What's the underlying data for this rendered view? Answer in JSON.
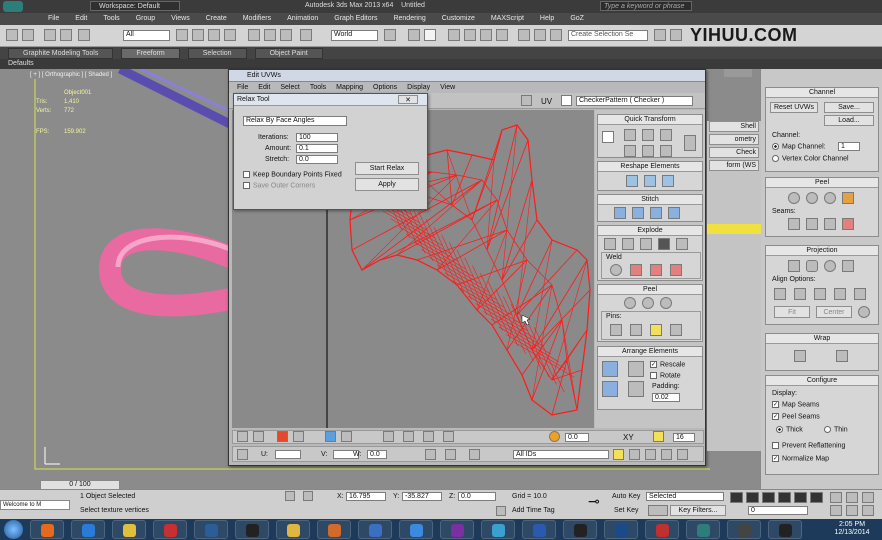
{
  "app": {
    "title": "Autodesk 3ds Max 2013 x64",
    "doc": "Untitled",
    "workspace": "Workspace: Default",
    "search_placeholder": "Type a keyword or phrase"
  },
  "menu": [
    "File",
    "Edit",
    "Tools",
    "Group",
    "Views",
    "Create",
    "Modifiers",
    "Animation",
    "Graph Editors",
    "Rendering",
    "Customize",
    "MAXScript",
    "Help",
    "GoZ"
  ],
  "toolbar": {
    "filter": "All",
    "coord": "World",
    "sel_set": "Create Selection Se"
  },
  "ribbon": [
    "Graphite Modeling Tools",
    "Freeform",
    "Selection",
    "Object Paint"
  ],
  "defaults": "Defaults",
  "watermark": "YIHUU.COM",
  "viewport": {
    "label": "[ + ] [ Orthographic ] [ Shaded ]",
    "stats": [
      [
        "",
        "Object001"
      ],
      [
        "Tris:",
        "1,410"
      ],
      [
        "Verts:",
        "772"
      ],
      [
        "FPS:",
        "159.902"
      ]
    ]
  },
  "uv": {
    "title": "Edit UVWs",
    "menu": [
      "File",
      "Edit",
      "Select",
      "Tools",
      "Mapping",
      "Options",
      "Display",
      "View"
    ],
    "uv_label": "UV",
    "checker": "CheckerPattern ( Checker )",
    "bottom": {
      "u_label": "U:",
      "v_label": "V:",
      "w_label": "W:",
      "w_val": "0.0",
      "all_ids": "All IDs",
      "xy": "XY",
      "spin1": "0.0",
      "spin2": "16"
    },
    "panels": {
      "quick": "Quick Transform",
      "reshape": "Reshape Elements",
      "stitch": "Stitch",
      "explode": "Explode",
      "weld": "Weld",
      "peel": "Peel",
      "pins": "Pins:",
      "arrange": "Arrange Elements",
      "rescale": "Rescale",
      "rotate": "Rotate",
      "padding_label": "Padding:",
      "padding": "0.02"
    }
  },
  "relax": {
    "title": "Relax Tool",
    "method": "Relax By Face Angles",
    "iter_label": "Iterations:",
    "iter": "100",
    "amount_label": "Amount:",
    "amount": "0.1",
    "stretch_label": "Stretch:",
    "stretch": "0.0",
    "start": "Start Relax",
    "apply": "Apply",
    "keep": "Keep Boundary Points Fixed",
    "save_corners": "Save Outer Corners"
  },
  "cmd": {
    "channel_title": "Channel",
    "reset": "Reset UVWs",
    "save": "Save...",
    "load": "Load...",
    "channel_lbl": "Channel:",
    "map_channel": "Map Channel:",
    "map_val": "1",
    "vertex_color": "Vertex Color Channel",
    "peel": "Peel",
    "seams": "Seams:",
    "projection": "Projection",
    "align": "Align Options:",
    "fit": "Fit",
    "center": "Center",
    "wrap": "Wrap",
    "configure": "Configure",
    "display": "Display:",
    "map_seams": "Map Seams",
    "peel_seams": "Peel Seams",
    "thick": "Thick",
    "thin": "Thin",
    "prevent": "Prevent Reflattening",
    "normalize": "Normalize Map",
    "side_stubs": [
      "Shell",
      "ometry",
      "Check",
      "form (WS"
    ]
  },
  "timeline": {
    "frame": "0 / 100",
    "selected": "1 Object Selected",
    "prompt": "Select texture vertices",
    "x_lbl": "X:",
    "x": "16.795",
    "y_lbl": "Y:",
    "y": "-35.827",
    "z_lbl": "Z:",
    "z": "0.0",
    "grid": "Grid = 10.0",
    "autokey": "Auto Key",
    "setkey": "Set Key",
    "sel_mode": "Selected",
    "key_filters": "Key Filters...",
    "add_tag": "Add Time Tag",
    "frame_field": "0",
    "welcome": "Welcome to M"
  },
  "taskbar": {
    "time": "2:05 PM",
    "date": "12/13/2014"
  },
  "colors": {
    "wire": "#ff1a1a",
    "tube": "#e86aa0",
    "accent": "#f0e040"
  }
}
